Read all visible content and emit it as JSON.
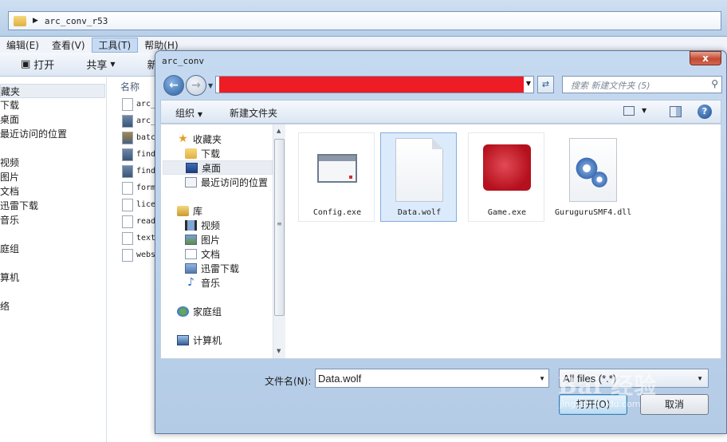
{
  "background_window": {
    "address_path": "arc_conv_r53",
    "menu": [
      "编辑(E)",
      "查看(V)",
      "工具(T)",
      "帮助(H)"
    ],
    "toolbar": {
      "open": "打开",
      "share": "共享",
      "new": "新建"
    },
    "nav_items": [
      "藏夹",
      "下载",
      "桌面",
      "最近访问的位置",
      "",
      "视频",
      "图片",
      "文档",
      "迅雷下载",
      "音乐",
      "",
      "庭组",
      "",
      "算机",
      "",
      "络"
    ],
    "files_header": "名称",
    "files": [
      "arc_",
      "arc_",
      "batc",
      "find",
      "find",
      "form",
      "lice",
      "read",
      "text",
      "webs"
    ]
  },
  "dialog": {
    "title": "arc_conv",
    "close_label": "x",
    "search_placeholder": "搜索 新建文件夹 (5)",
    "command_bar": {
      "organize": "组织",
      "new_folder": "新建文件夹"
    },
    "nav": {
      "favorites": "收藏夹",
      "downloads": "下载",
      "desktop": "桌面",
      "recent": "最近访问的位置",
      "libraries": "库",
      "videos": "视频",
      "pictures": "图片",
      "documents": "文档",
      "thunder": "迅雷下载",
      "music": "音乐",
      "homegroup": "家庭组",
      "computer": "计算机"
    },
    "files": [
      {
        "name": "Config.exe",
        "icon": "window-exe-icon"
      },
      {
        "name": "Data.wolf",
        "icon": "blank-document-icon",
        "selected": true
      },
      {
        "name": "Game.exe",
        "icon": "game-wolf-icon"
      },
      {
        "name": "GuruguruSMF4.dll",
        "icon": "gear-dll-icon"
      }
    ],
    "filename_label": "文件名(N):",
    "filename_value": "Data.wolf",
    "filter_value": "All files (*.*)",
    "open_button": "打开(O)",
    "cancel_button": "取消"
  },
  "watermark": {
    "logo": "Bai 经验",
    "url": "jingyan.baidu.com"
  }
}
